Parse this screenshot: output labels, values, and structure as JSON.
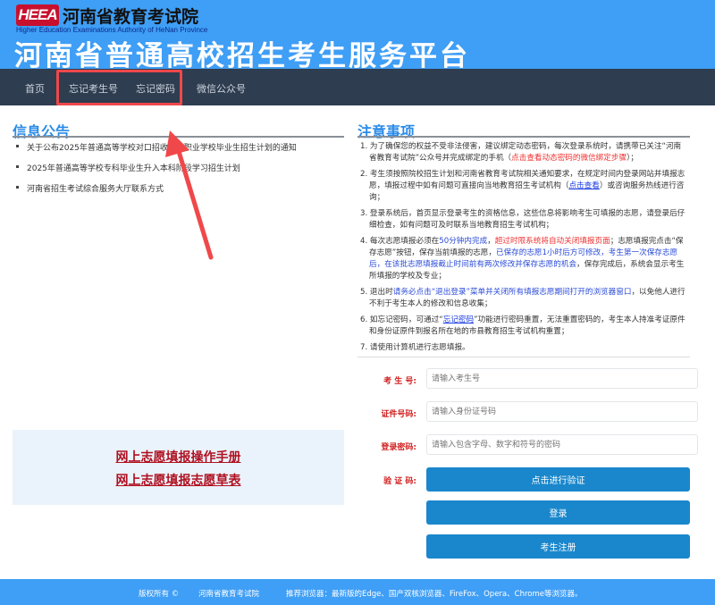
{
  "header": {
    "logo_text": "HEEA",
    "org_name": "河南省教育考试院",
    "org_name_en": "Higher Education Examinations Authority of HeNan Province",
    "site_title": "河南省普通高校招生考生服务平台"
  },
  "nav": [
    "首页",
    "忘记考生号",
    "忘记密码",
    "微信公众号"
  ],
  "news": {
    "title": "信息公告",
    "items": [
      "关于公布2025年普通高等学校对口招收中等职业学校毕业生招生计划的通知",
      "2025年普通高等学校专科毕业生升入本科阶段学习招生计划",
      "河南省招生考试综合服务大厅联系方式"
    ]
  },
  "notices": {
    "title": "注意事项",
    "items": [
      [
        {
          "t": "1. 为了确保您的权益不受非法侵害，建议绑定动态密码，每次登录系统时，请携带已关注“河南省教育考试院”公众号并完成绑定的手机（"
        },
        {
          "t": "点击查看动态密码的微信绑定步骤",
          "c": "red"
        },
        {
          "t": "）；"
        }
      ],
      [
        {
          "t": "2. 考生须按照院校招生计划和河南省教育考试院相关通知要求，在规定时间内登录网站并填报志愿，填报过程中如有问题可直接向当地教育招生考试机构（"
        },
        {
          "t": "点击查看",
          "c": "link"
        },
        {
          "t": "）或咨询服务热线进行咨询；"
        }
      ],
      [
        {
          "t": "3. 登录系统后，首页显示登录考生的资格信息，这些信息将影响考生可填报的志愿，请登录后仔细检查，如有问题可及时联系当地教育招生考试机构；"
        }
      ],
      [
        {
          "t": "4. 每次志愿填报必须在"
        },
        {
          "t": "50分钟内完成",
          "c": "blue"
        },
        {
          "t": "，"
        },
        {
          "t": "超过时限系统将自动关闭填报页面",
          "c": "red"
        },
        {
          "t": "；志愿填报完点击“保存志愿”按钮，保存当前填报的志愿，"
        },
        {
          "t": "已保存的志愿1小时后方可修改，考生第一次保存志愿后，在该批志愿填报截止时间前有两次修改并保存志愿的机会",
          "c": "blue"
        },
        {
          "t": "，保存完成后，系统会显示考生所填报的学校及专业；"
        }
      ],
      [
        {
          "t": "5. 退出时"
        },
        {
          "t": "请务必点击“退出登录”菜单并关闭所有填报志愿期间打开的浏览器窗口",
          "c": "blue"
        },
        {
          "t": "，以免他人进行不利于考生本人的修改和信息收集；"
        }
      ],
      [
        {
          "t": "6. 如忘记密码，可通过“"
        },
        {
          "t": "忘记密码",
          "c": "link"
        },
        {
          "t": "”功能进行密码重置，无法重置密码的，考生本人持准考证原件和身份证原件到报名所在地的市县教育招生考试机构重置；"
        }
      ],
      [
        {
          "t": "7. 请使用计算机进行志愿填报。"
        }
      ]
    ]
  },
  "links": [
    "网上志愿填报操作手册",
    "网上志愿填报志愿草表"
  ],
  "form": {
    "candidate_label": "考 生 号:",
    "candidate_placeholder": "请输入考生号",
    "id_label": "证件号码:",
    "id_placeholder": "请输入身份证号码",
    "password_label": "登录密码:",
    "password_placeholder": "请输入包含字母、数字和符号的密码",
    "captcha_label": "验 证 码:",
    "verify_button": "点击进行验证",
    "login_button": "登录",
    "register_button": "考生注册"
  },
  "footer": {
    "copyright": "版权所有 ©",
    "org": "河南省教育考试院",
    "browsers": "推荐浏览器：最新版的Edge、国产双核浏览器、FireFox、Opera、Chrome等浏览器。"
  },
  "colors": {
    "header": "#3f9ef5",
    "nav": "#2e3d50",
    "button": "#1a87cc",
    "annotation": "#f0484a"
  }
}
